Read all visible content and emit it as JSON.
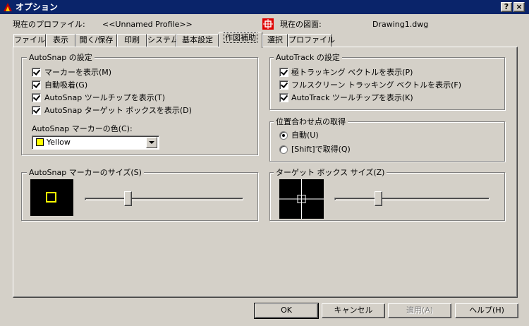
{
  "window": {
    "title": "オプション",
    "help_btn": "?",
    "close_btn": "×"
  },
  "profile": {
    "label": "現在のプロファイル:",
    "value": "<<Unnamed Profile>>",
    "drawing_label": "現在の図面:",
    "drawing_value": "Drawing1.dwg"
  },
  "tabs": [
    {
      "label": "ファイル"
    },
    {
      "label": "表示"
    },
    {
      "label": "開く/保存"
    },
    {
      "label": "印刷"
    },
    {
      "label": "システム"
    },
    {
      "label": "基本設定"
    },
    {
      "label": "作図補助"
    },
    {
      "label": "選択"
    },
    {
      "label": "プロファイル"
    }
  ],
  "autosnap": {
    "title": "AutoSnap の設定",
    "options": [
      {
        "label": "マーカーを表示(M)"
      },
      {
        "label": "自動吸着(G)"
      },
      {
        "label": "AutoSnap ツールチップを表示(T)"
      },
      {
        "label": "AutoSnap ターゲット ボックスを表示(D)"
      }
    ],
    "color_label": "AutoSnap マーカーの色(C):",
    "color_value": "Yellow",
    "color_hex": "#ffff00"
  },
  "autotrack": {
    "title": "AutoTrack の設定",
    "options": [
      {
        "label": "極トラッキング ベクトルを表示(P)"
      },
      {
        "label": "フルスクリーン トラッキング ベクトルを表示(F)"
      },
      {
        "label": "AutoTrack ツールチップを表示(K)"
      }
    ]
  },
  "alignment": {
    "title": "位置合わせ点の取得",
    "options": [
      {
        "label": "自動(U)",
        "selected": true
      },
      {
        "label": "[Shift]で取得(Q)",
        "selected": false
      }
    ]
  },
  "marker_size": {
    "title": "AutoSnap マーカーのサイズ(S)",
    "level": 0.27
  },
  "aperture_size": {
    "title": "ターゲット ボックス サイズ(Z)",
    "level": 0.28
  },
  "buttons": {
    "ok": "OK",
    "cancel": "キャンセル",
    "apply": "適用(A)",
    "help": "ヘルプ(H)"
  }
}
